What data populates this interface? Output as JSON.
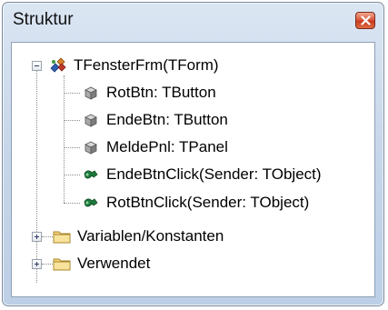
{
  "window": {
    "title": "Struktur"
  },
  "tree": {
    "root": {
      "label": "TFensterFrm(TForm)",
      "icon": "form-icon",
      "expanded": true
    },
    "children": [
      {
        "label": "RotBtn: TButton",
        "icon": "component-icon"
      },
      {
        "label": "EndeBtn: TButton",
        "icon": "component-icon"
      },
      {
        "label": "MeldePnl: TPanel",
        "icon": "component-icon"
      },
      {
        "label": "EndeBtnClick(Sender: TObject)",
        "icon": "method-icon"
      },
      {
        "label": "RotBtnClick(Sender: TObject)",
        "icon": "method-icon"
      }
    ],
    "folders": [
      {
        "label": "Variablen/Konstanten",
        "icon": "folder-icon",
        "expanded": false
      },
      {
        "label": "Verwendet",
        "icon": "folder-icon",
        "expanded": false
      }
    ]
  }
}
